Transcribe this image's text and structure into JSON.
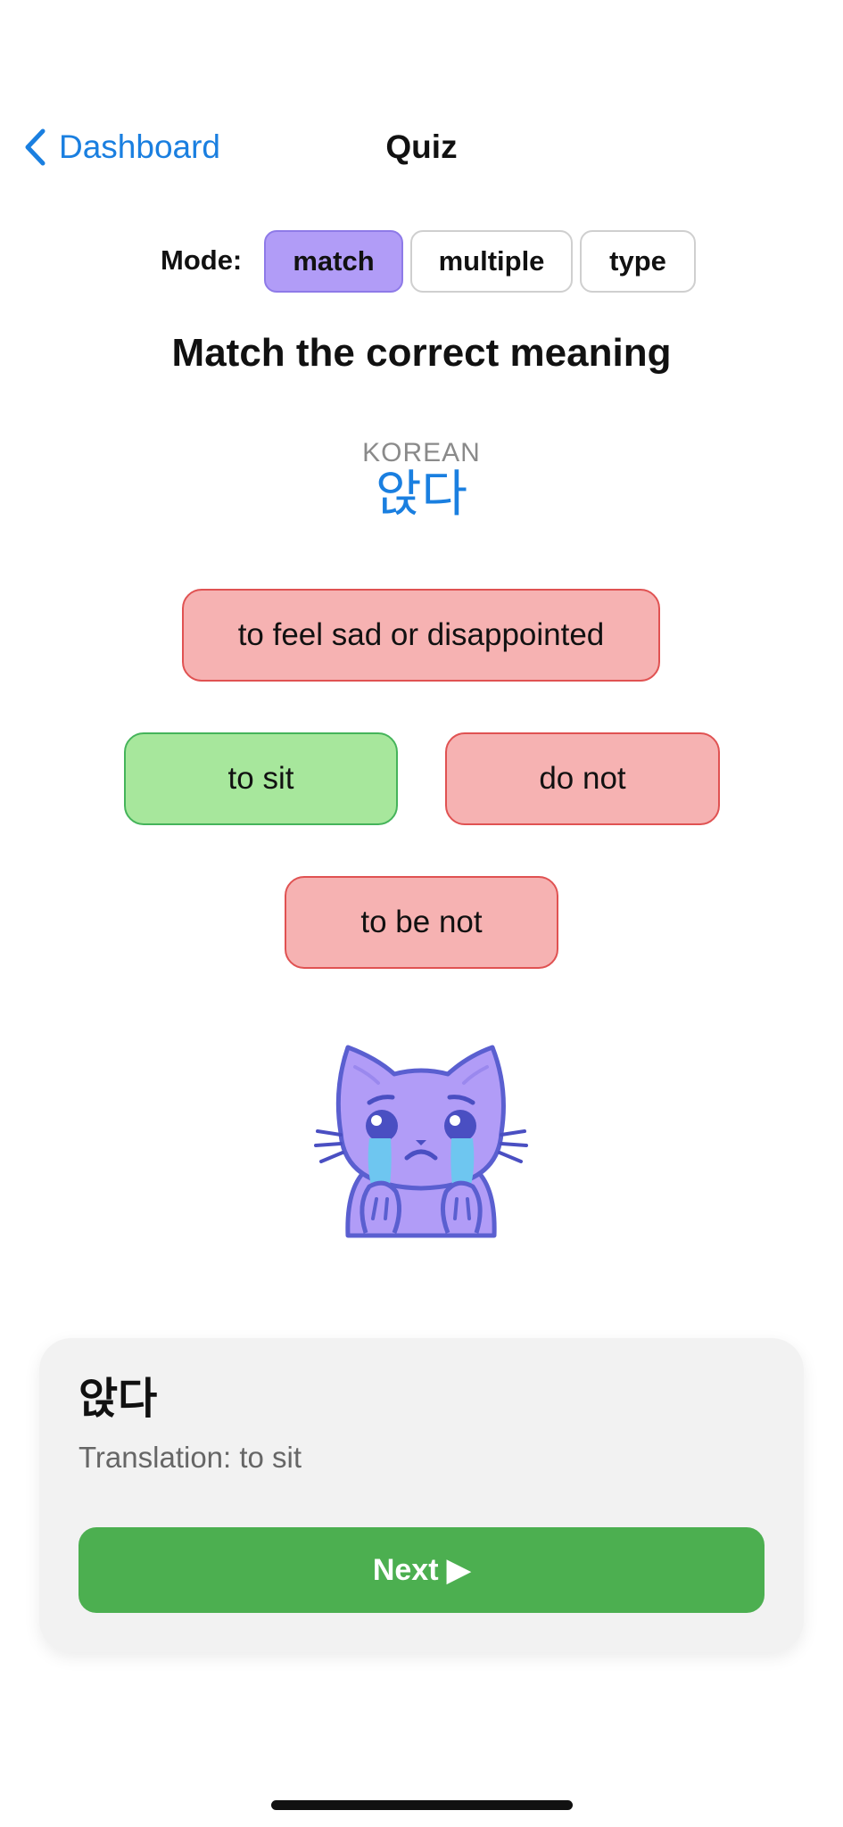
{
  "nav": {
    "back_label": "Dashboard",
    "title": "Quiz"
  },
  "mode": {
    "label": "Mode:",
    "options": [
      "match",
      "multiple",
      "type"
    ],
    "selected": "match"
  },
  "prompt": "Match the correct meaning",
  "word_card": {
    "language": "KOREAN",
    "word": "앉다"
  },
  "options": [
    {
      "label": "to feel sad or disappointed",
      "state": "incorrect"
    },
    {
      "label": "to sit",
      "state": "correct"
    },
    {
      "label": "do not",
      "state": "incorrect"
    },
    {
      "label": "to be not",
      "state": "incorrect"
    }
  ],
  "mascot": {
    "icon": "crying-cat-icon"
  },
  "feedback": {
    "word": "앉다",
    "translation": "Translation: to sit",
    "next_label": "Next ▶"
  },
  "colors": {
    "accent_blue": "#1a7fe0",
    "mode_active": "#b19cf7",
    "incorrect_bg": "#f6b2b2",
    "incorrect_border": "#e05252",
    "correct_bg": "#a7e79c",
    "correct_border": "#45b45a",
    "next_button": "#4caf50"
  }
}
